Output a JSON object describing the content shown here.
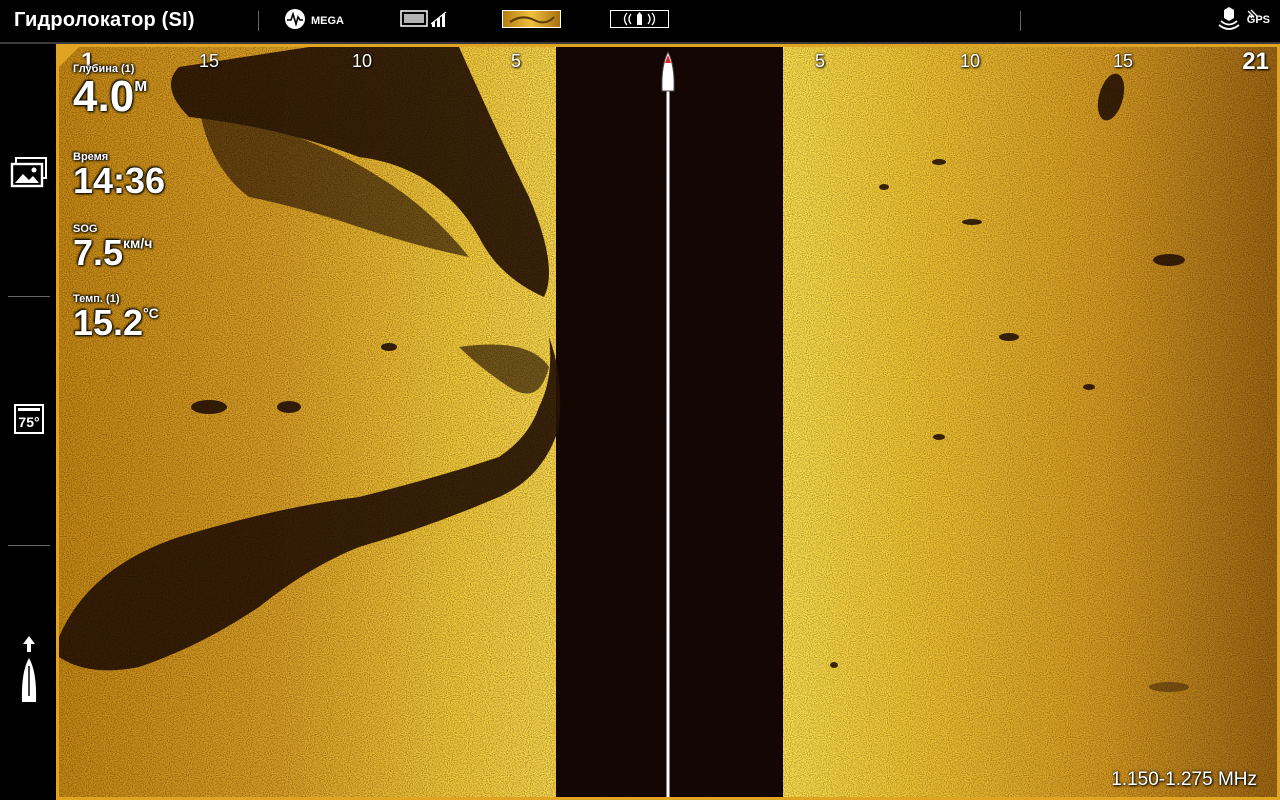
{
  "topbar": {
    "title": "Гидролокатор (SI)",
    "mega_label": "MEGA",
    "gps_label": "GPS"
  },
  "sonar": {
    "scale": {
      "left_edge": "1",
      "left": [
        "15",
        "10",
        "5"
      ],
      "right": [
        "5",
        "10",
        "15"
      ],
      "right_edge": "21"
    },
    "readouts": {
      "depth": {
        "label": "Глубина (1)",
        "value": "4.0",
        "unit": "м"
      },
      "time": {
        "label": "Время",
        "value": "14:36"
      },
      "sog": {
        "label": "SOG",
        "value": "7.5",
        "unit": "км/ч"
      },
      "temp": {
        "label": "Темп. (1)",
        "value": "15.2",
        "unit": "°C"
      }
    },
    "frequency": "1.150-1.275 MHz"
  },
  "rail": {
    "beam_angle": "75°"
  },
  "colors": {
    "sonar_bright": "#f2c030",
    "sonar_mid": "#d69a1e",
    "sonar_dark": "#1b0c05",
    "frame_accent": "#e0a322"
  }
}
